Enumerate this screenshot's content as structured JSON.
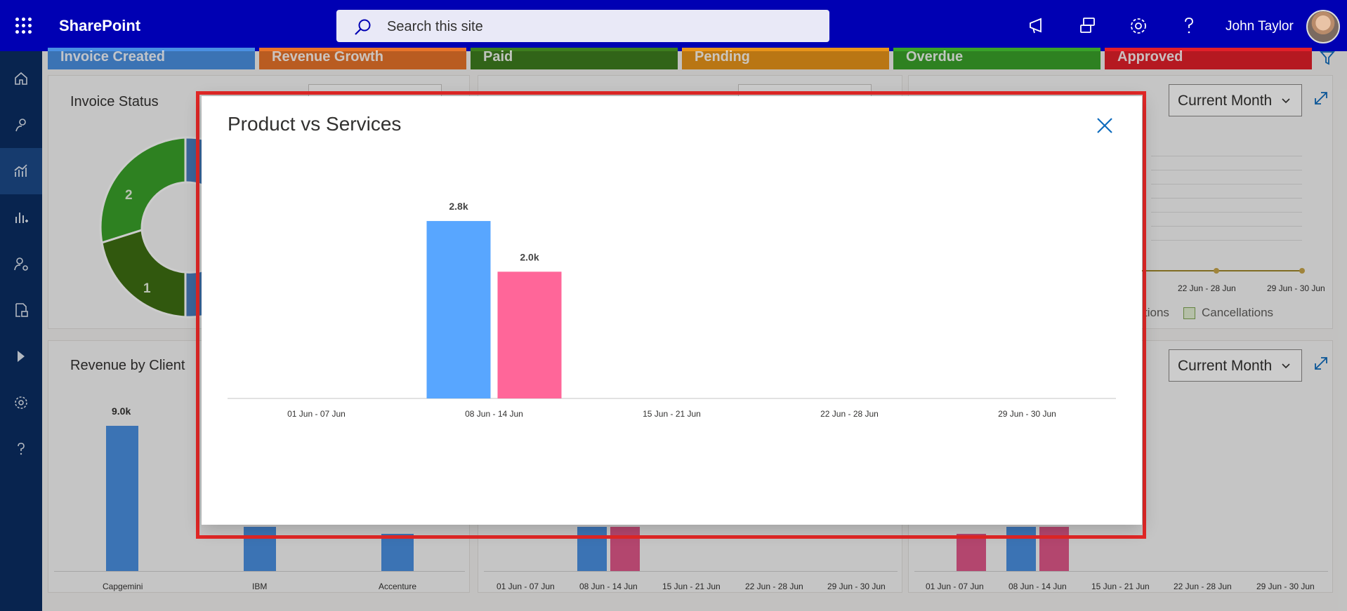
{
  "app": {
    "brand": "SharePoint",
    "search_placeholder": "Search this site",
    "user_name": "John Taylor"
  },
  "status_tiles": [
    {
      "label": "Invoice Created",
      "color": "#4a90e2"
    },
    {
      "label": "Revenue Growth",
      "color": "#e8742a"
    },
    {
      "label": "Paid",
      "color": "#3e7d1e"
    },
    {
      "label": "Pending",
      "color": "#e8941a"
    },
    {
      "label": "Overdue",
      "color": "#3aa22a"
    },
    {
      "label": "Approved",
      "color": "#e3202a"
    }
  ],
  "cards": {
    "invoice_status": {
      "title": "Invoice Status",
      "donut_labels": [
        "2",
        "1"
      ]
    },
    "right_top": {
      "dropdown": "Current Month",
      "tick_labels": [
        "22 Jun - 28 Jun",
        "29 Jun - 30 Jun"
      ],
      "legend_partial": "tions",
      "legend_cancellations": "Cancellations"
    },
    "revenue_by_client": {
      "title": "Revenue by Client",
      "value_label": "9.0k",
      "categories": [
        "Capgemini",
        "IBM",
        "Accenture"
      ]
    },
    "bottom_middle": {
      "tick_labels": [
        "01 Jun - 07 Jun",
        "08 Jun - 14 Jun",
        "15 Jun - 21 Jun",
        "22 Jun - 28 Jun",
        "29 Jun - 30 Jun"
      ]
    },
    "bottom_right": {
      "dropdown": "Current Month",
      "tick_labels": [
        "01 Jun - 07 Jun",
        "08 Jun - 14 Jun",
        "15 Jun - 21 Jun",
        "22 Jun - 28 Jun",
        "29 Jun - 30 Jun"
      ]
    }
  },
  "modal": {
    "title": "Product vs Services"
  },
  "colors": {
    "product": "#58a6ff",
    "services": "#ff6699",
    "accent": "#0f6cbd",
    "highlight": "#e32726"
  },
  "chart_data": {
    "type": "bar",
    "categories": [
      "01 Jun - 07 Jun",
      "08 Jun - 14 Jun",
      "15 Jun - 21 Jun",
      "22 Jun - 28 Jun",
      "29 Jun - 30 Jun"
    ],
    "series": [
      {
        "values": [
          0,
          2800,
          0,
          0,
          0
        ],
        "labels": [
          "",
          "2.8k",
          "",
          "",
          ""
        ],
        "color": "#58a6ff"
      },
      {
        "values": [
          0,
          2000,
          0,
          0,
          0
        ],
        "labels": [
          "",
          "2.0k",
          "",
          "",
          ""
        ],
        "color": "#ff6699"
      }
    ],
    "ylim": [
      0,
      3000
    ],
    "grid": false,
    "title": "Product vs Services"
  }
}
